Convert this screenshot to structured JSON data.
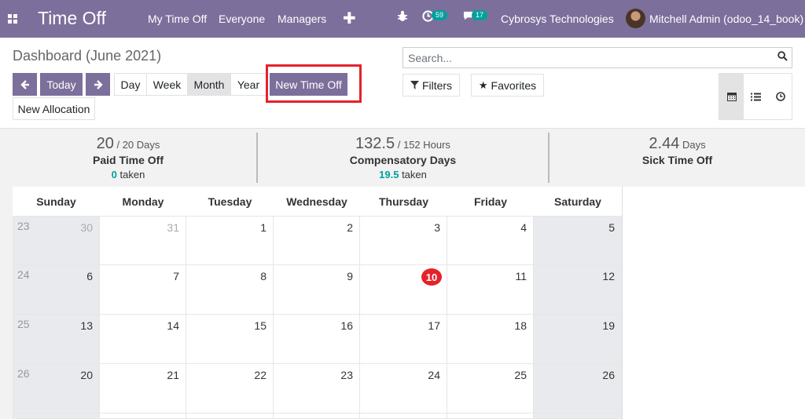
{
  "navbar": {
    "app_title": "Time Off",
    "menus": [
      "My Time Off",
      "Everyone",
      "Managers"
    ],
    "plus_icon": "plus-icon",
    "activity_count": "59",
    "message_count": "17",
    "company": "Cybrosys Technologies",
    "user": "Mitchell Admin (odoo_14_book)"
  },
  "control": {
    "title": "Dashboard (June 2021)",
    "today_label": "Today",
    "scales": [
      "Day",
      "Week",
      "Month",
      "Year"
    ],
    "active_scale": "Month",
    "new_time_off_label": "New Time Off",
    "new_allocation_label": "New Allocation",
    "search_placeholder": "Search...",
    "filters_label": "Filters",
    "favorites_label": "Favorites"
  },
  "summary": [
    {
      "value": "20",
      "unit": "/ 20 Days",
      "name": "Paid Time Off",
      "taken_value": "0",
      "taken_label": "taken"
    },
    {
      "value": "132.5",
      "unit": "/ 152 Hours",
      "name": "Compensatory Days",
      "taken_value": "19.5",
      "taken_label": "taken"
    },
    {
      "value": "2.44",
      "unit": "Days",
      "name": "Sick Time Off",
      "taken_value": "",
      "taken_label": ""
    }
  ],
  "calendar": {
    "weekdays": [
      "Sunday",
      "Monday",
      "Tuesday",
      "Wednesday",
      "Thursday",
      "Friday",
      "Saturday"
    ],
    "weeks": [
      {
        "week": "23",
        "days": [
          "30",
          "31",
          "1",
          "2",
          "3",
          "4",
          "5"
        ]
      },
      {
        "week": "24",
        "days": [
          "6",
          "7",
          "8",
          "9",
          "10",
          "11",
          "12"
        ]
      },
      {
        "week": "25",
        "days": [
          "13",
          "14",
          "15",
          "16",
          "17",
          "18",
          "19"
        ]
      },
      {
        "week": "26",
        "days": [
          "20",
          "21",
          "22",
          "23",
          "24",
          "25",
          "26"
        ]
      }
    ],
    "today": "10",
    "colors": {
      "today": "#e5222b",
      "weekend": "#e8eaed",
      "brand": "#7c6f9b",
      "accent": "#00a09d"
    }
  }
}
